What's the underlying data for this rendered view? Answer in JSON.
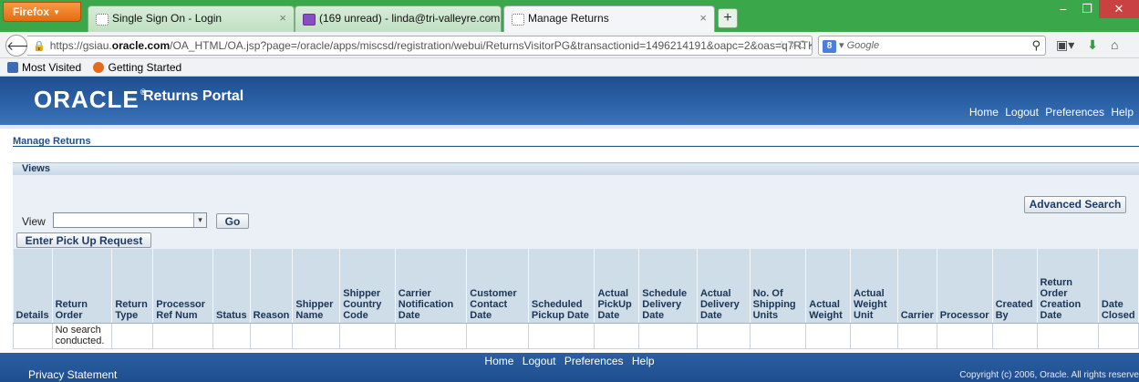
{
  "browser": {
    "menu_label": "Firefox",
    "tabs": [
      {
        "label": "Single Sign On - Login"
      },
      {
        "label": "(169 unread) - linda@tri-valleyre.com..."
      },
      {
        "label": "Manage Returns"
      }
    ],
    "url_prefix": "https://gsiau.",
    "url_domain": "oracle.com",
    "url_path": "/OA_HTML/OA.jsp?page=/oracle/apps/miscsd/registration/webui/ReturnsVisitorPG&transactionid=1496214191&oapc=2&oas=q7RTK",
    "search_placeholder": "Google",
    "bookmarks": [
      {
        "label": "Most Visited",
        "icon": "most-visited-icon"
      },
      {
        "label": "Getting Started",
        "icon": "firefox-icon"
      }
    ]
  },
  "branding": {
    "logo": "ORACLE",
    "product": "Returns Portal",
    "global_links": [
      "Home",
      "Logout",
      "Preferences",
      "Help"
    ]
  },
  "page": {
    "title": "Manage Returns",
    "views_header": "Views",
    "advanced_search": "Advanced Search",
    "view_label": "View",
    "view_value": "",
    "go_label": "Go",
    "pickup_button": "Enter Pick Up Request"
  },
  "table": {
    "columns": [
      "Details",
      "Return Order",
      "Return Type",
      "Processor Ref Num",
      "Status",
      "Reason",
      "Shipper Name",
      "Shipper Country Code",
      "Carrier Notification Date",
      "Customer Contact Date",
      "Scheduled Pickup Date",
      "Actual PickUp Date",
      "Schedule Delivery Date",
      "Actual Delivery Date",
      "No. Of Shipping Units",
      "Actual Weight",
      "Actual Weight Unit",
      "Carrier",
      "Processor",
      "Created By",
      "Return Order Creation Date",
      "Date Closed"
    ],
    "empty_message": "No search conducted."
  },
  "footer": {
    "links": [
      "Home",
      "Logout",
      "Preferences",
      "Help"
    ],
    "privacy": "Privacy Statement",
    "copyright": "Copyright (c) 2006, Oracle. All rights reserve"
  },
  "colors": {
    "brand_blue": "#1f4e8f",
    "header_cell": "#cfdde9",
    "firefox_green": "#3aa74a"
  }
}
